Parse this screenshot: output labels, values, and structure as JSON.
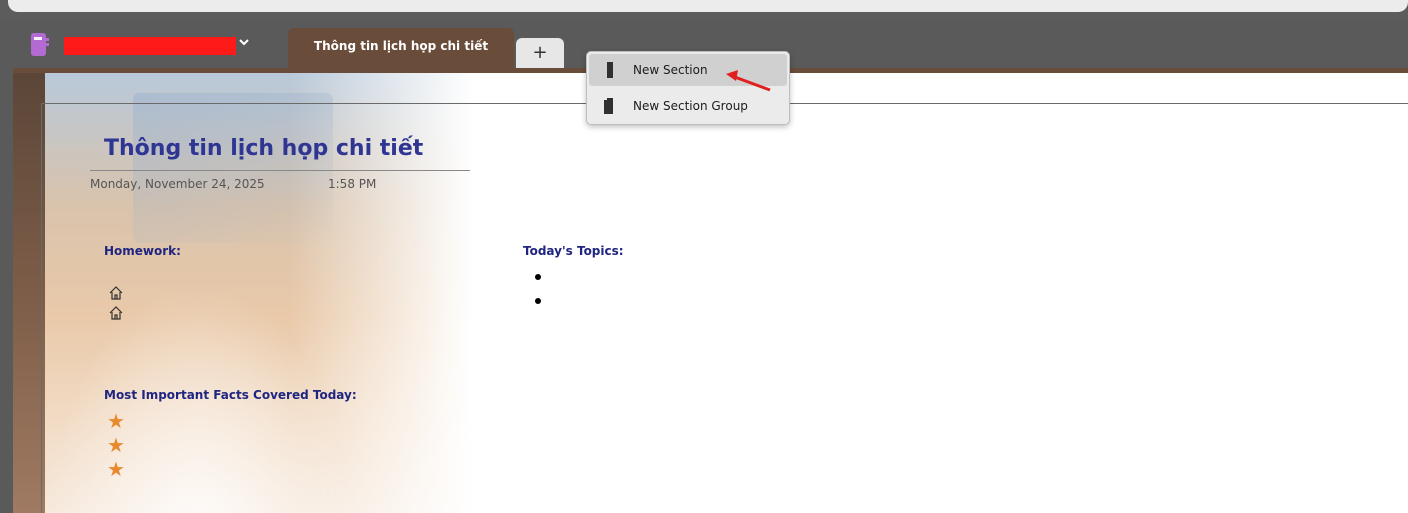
{
  "notebook": {
    "name": "",
    "icon": "notebook-icon",
    "chevron": "chevron-down-icon"
  },
  "tabs": {
    "active_label": "Thông tin lịch họp chi tiết",
    "add_label": "+"
  },
  "menu": {
    "items": [
      {
        "label": "New Section",
        "icon": "section-icon"
      },
      {
        "label": "New Section Group",
        "icon": "section-group-icon"
      }
    ]
  },
  "page": {
    "title": "Thông tin lịch họp chi tiết",
    "date": "Monday, November 24, 2025",
    "time": "1:58 PM",
    "homework_heading": "Homework:",
    "topics_heading": "Today's Topics:",
    "facts_heading": "Most Important Facts Covered Today:"
  },
  "colors": {
    "tab_active": "#6a4c3a",
    "title_blue": "#2f3592",
    "heading_blue": "#1f2580",
    "star_orange": "#e9892e",
    "notebook_purple": "#b36bd3",
    "redaction": "#ff1a1a",
    "arrow_red": "#e0201f"
  }
}
